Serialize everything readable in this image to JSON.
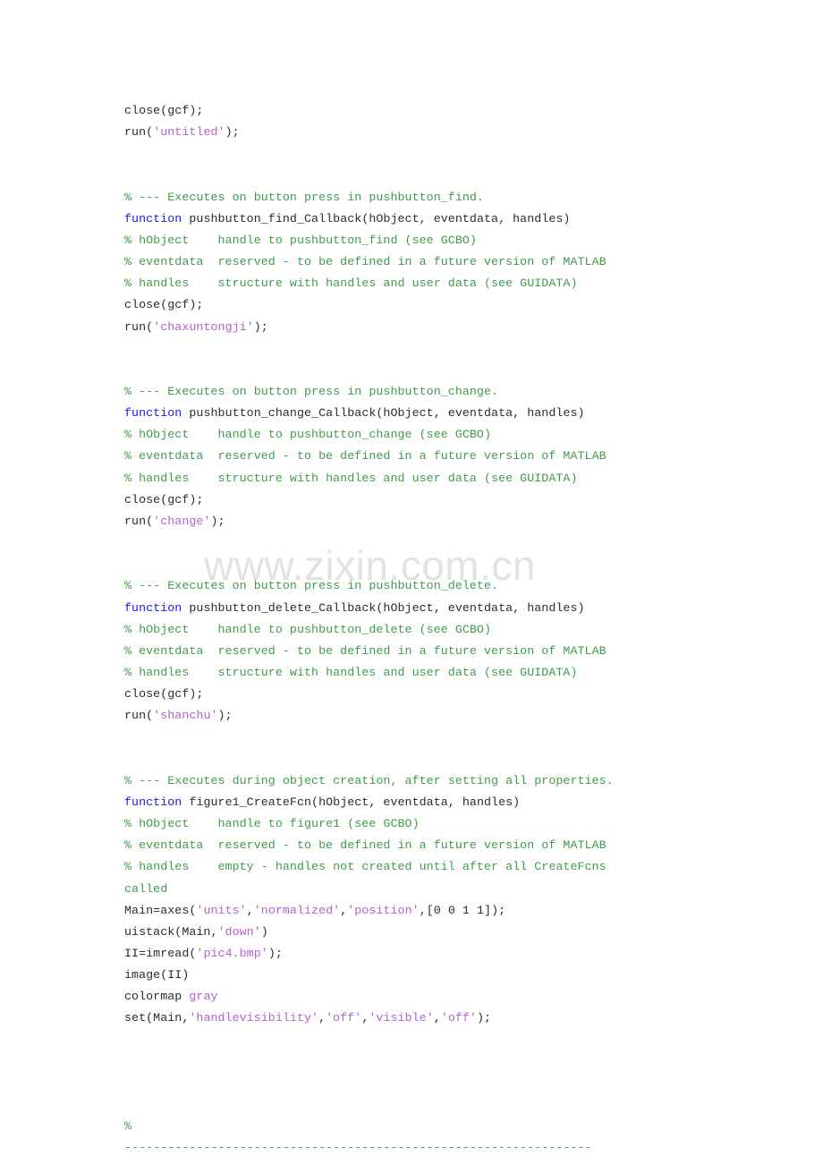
{
  "document": {
    "kind": "matlab-source-listing",
    "watermark": "www.zixin.com.cn"
  },
  "colors": {
    "background": "#ffffff",
    "plain": "#2b2b2b",
    "comment": "#3f9b4b",
    "keyword": "#1a1ae0",
    "string": "#b45fce",
    "watermark": "#e2e2e4"
  },
  "code": {
    "lines": [
      {
        "id": "l1",
        "tokens": [
          {
            "t": "plain",
            "s": "close(gcf);"
          }
        ]
      },
      {
        "id": "l2",
        "tokens": [
          {
            "t": "plain",
            "s": "run("
          },
          {
            "t": "string",
            "s": "'untitled'"
          },
          {
            "t": "plain",
            "s": ");"
          }
        ]
      },
      {
        "id": "l3",
        "tokens": []
      },
      {
        "id": "l4",
        "tokens": []
      },
      {
        "id": "l5",
        "tokens": [
          {
            "t": "comment",
            "s": "% --- Executes on button press in pushbutton_find."
          }
        ]
      },
      {
        "id": "l6",
        "tokens": [
          {
            "t": "keyword",
            "s": "function"
          },
          {
            "t": "plain",
            "s": " pushbutton_find_Callback(hObject, eventdata, handles)"
          }
        ]
      },
      {
        "id": "l7",
        "tokens": [
          {
            "t": "comment",
            "s": "% hObject    handle to pushbutton_find (see GCBO)"
          }
        ]
      },
      {
        "id": "l8",
        "tokens": [
          {
            "t": "comment",
            "s": "% eventdata  reserved - to be defined in a future version of MATLAB"
          }
        ]
      },
      {
        "id": "l9",
        "tokens": [
          {
            "t": "comment",
            "s": "% handles    structure with handles and user data (see GUIDATA)"
          }
        ]
      },
      {
        "id": "l10",
        "tokens": [
          {
            "t": "plain",
            "s": "close(gcf);"
          }
        ]
      },
      {
        "id": "l11",
        "tokens": [
          {
            "t": "plain",
            "s": "run("
          },
          {
            "t": "string",
            "s": "'chaxuntongji'"
          },
          {
            "t": "plain",
            "s": ");"
          }
        ]
      },
      {
        "id": "l12",
        "tokens": []
      },
      {
        "id": "l13",
        "tokens": []
      },
      {
        "id": "l14",
        "tokens": [
          {
            "t": "comment",
            "s": "% --- Executes on button press in pushbutton_change."
          }
        ]
      },
      {
        "id": "l15",
        "tokens": [
          {
            "t": "keyword",
            "s": "function"
          },
          {
            "t": "plain",
            "s": " pushbutton_change_Callback(hObject, eventdata, handles)"
          }
        ]
      },
      {
        "id": "l16",
        "tokens": [
          {
            "t": "comment",
            "s": "% hObject    handle to pushbutton_change (see GCBO)"
          }
        ]
      },
      {
        "id": "l17",
        "tokens": [
          {
            "t": "comment",
            "s": "% eventdata  reserved - to be defined in a future version of MATLAB"
          }
        ]
      },
      {
        "id": "l18",
        "tokens": [
          {
            "t": "comment",
            "s": "% handles    structure with handles and user data (see GUIDATA)"
          }
        ]
      },
      {
        "id": "l19",
        "tokens": [
          {
            "t": "plain",
            "s": "close(gcf);"
          }
        ]
      },
      {
        "id": "l20",
        "tokens": [
          {
            "t": "plain",
            "s": "run("
          },
          {
            "t": "string",
            "s": "'change'"
          },
          {
            "t": "plain",
            "s": ");"
          }
        ]
      },
      {
        "id": "l21",
        "tokens": []
      },
      {
        "id": "l22",
        "tokens": []
      },
      {
        "id": "l23",
        "tokens": [
          {
            "t": "comment",
            "s": "% --- Executes on button press in pushbutton_delete."
          }
        ]
      },
      {
        "id": "l24",
        "tokens": [
          {
            "t": "keyword",
            "s": "function"
          },
          {
            "t": "plain",
            "s": " pushbutton_delete_Callback(hObject, eventdata, handles)"
          }
        ]
      },
      {
        "id": "l25",
        "tokens": [
          {
            "t": "comment",
            "s": "% hObject    handle to pushbutton_delete (see GCBO)"
          }
        ]
      },
      {
        "id": "l26",
        "tokens": [
          {
            "t": "comment",
            "s": "% eventdata  reserved - to be defined in a future version of MATLAB"
          }
        ]
      },
      {
        "id": "l27",
        "tokens": [
          {
            "t": "comment",
            "s": "% handles    structure with handles and user data (see GUIDATA)"
          }
        ]
      },
      {
        "id": "l28",
        "tokens": [
          {
            "t": "plain",
            "s": "close(gcf);"
          }
        ]
      },
      {
        "id": "l29",
        "tokens": [
          {
            "t": "plain",
            "s": "run("
          },
          {
            "t": "string",
            "s": "'shanchu'"
          },
          {
            "t": "plain",
            "s": ");"
          }
        ]
      },
      {
        "id": "l30",
        "tokens": []
      },
      {
        "id": "l31",
        "tokens": []
      },
      {
        "id": "l32",
        "tokens": [
          {
            "t": "comment",
            "s": "% --- Executes during object creation, after setting all properties."
          }
        ]
      },
      {
        "id": "l33",
        "tokens": [
          {
            "t": "keyword",
            "s": "function"
          },
          {
            "t": "plain",
            "s": " figure1_CreateFcn(hObject, eventdata, handles)"
          }
        ]
      },
      {
        "id": "l34",
        "tokens": [
          {
            "t": "comment",
            "s": "% hObject    handle to figure1 (see GCBO)"
          }
        ]
      },
      {
        "id": "l35",
        "tokens": [
          {
            "t": "comment",
            "s": "% eventdata  reserved - to be defined in a future version of MATLAB"
          }
        ]
      },
      {
        "id": "l36",
        "tokens": [
          {
            "t": "comment",
            "s": "% handles    empty - handles not created until after all CreateFcns"
          }
        ]
      },
      {
        "id": "l37",
        "tokens": [
          {
            "t": "comment",
            "s": "called"
          }
        ]
      },
      {
        "id": "l38",
        "tokens": [
          {
            "t": "plain",
            "s": "Main=axes("
          },
          {
            "t": "string",
            "s": "'units'"
          },
          {
            "t": "plain",
            "s": ","
          },
          {
            "t": "string",
            "s": "'normalized'"
          },
          {
            "t": "plain",
            "s": ","
          },
          {
            "t": "string",
            "s": "'position'"
          },
          {
            "t": "plain",
            "s": ",[0 0 1 1]);"
          }
        ]
      },
      {
        "id": "l39",
        "tokens": [
          {
            "t": "plain",
            "s": "uistack(Main,"
          },
          {
            "t": "string",
            "s": "'down'"
          },
          {
            "t": "plain",
            "s": ")"
          }
        ]
      },
      {
        "id": "l40",
        "tokens": [
          {
            "t": "plain",
            "s": "II=imread("
          },
          {
            "t": "string",
            "s": "'pic4.bmp'"
          },
          {
            "t": "plain",
            "s": ");"
          }
        ]
      },
      {
        "id": "l41",
        "tokens": [
          {
            "t": "plain",
            "s": "image(II)"
          }
        ]
      },
      {
        "id": "l42",
        "tokens": [
          {
            "t": "plain",
            "s": "colormap "
          },
          {
            "t": "string",
            "s": "gray"
          }
        ]
      },
      {
        "id": "l43",
        "tokens": [
          {
            "t": "plain",
            "s": "set(Main,"
          },
          {
            "t": "string",
            "s": "'handlevisibility'"
          },
          {
            "t": "plain",
            "s": ","
          },
          {
            "t": "string",
            "s": "'off'"
          },
          {
            "t": "plain",
            "s": ","
          },
          {
            "t": "string",
            "s": "'visible'"
          },
          {
            "t": "plain",
            "s": ","
          },
          {
            "t": "string",
            "s": "'off'"
          },
          {
            "t": "plain",
            "s": ");"
          }
        ]
      },
      {
        "id": "l44",
        "tokens": []
      },
      {
        "id": "l45",
        "tokens": []
      },
      {
        "id": "l46",
        "tokens": []
      },
      {
        "id": "l47",
        "tokens": []
      },
      {
        "id": "l48",
        "tokens": [
          {
            "t": "comment",
            "s": "%"
          }
        ]
      },
      {
        "id": "l49",
        "tokens": [
          {
            "t": "comment",
            "s": "-----------------------------------------------------------------"
          }
        ]
      }
    ]
  }
}
